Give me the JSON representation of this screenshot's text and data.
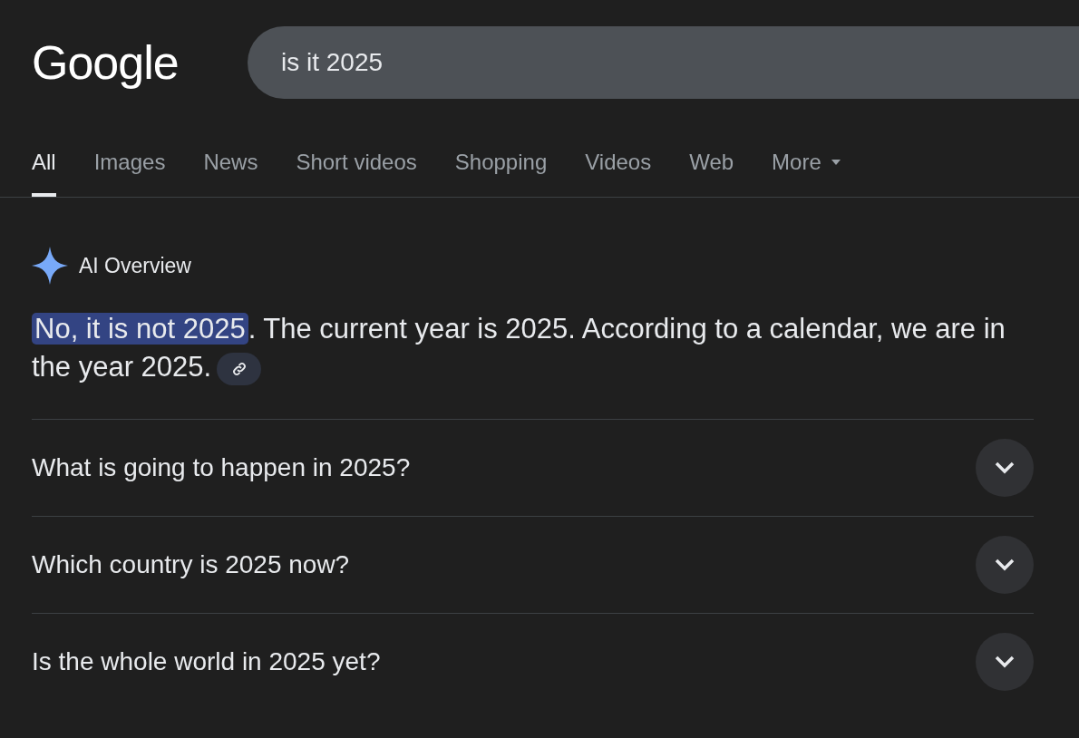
{
  "logo": "Google",
  "search": {
    "value": "is it 2025"
  },
  "tabs": [
    {
      "label": "All",
      "selected": true
    },
    {
      "label": "Images",
      "selected": false
    },
    {
      "label": "News",
      "selected": false
    },
    {
      "label": "Short videos",
      "selected": false
    },
    {
      "label": "Shopping",
      "selected": false
    },
    {
      "label": "Videos",
      "selected": false
    },
    {
      "label": "Web",
      "selected": false
    },
    {
      "label": "More",
      "selected": false,
      "kind": "menu"
    }
  ],
  "overview": {
    "title": "AI Overview",
    "highlight": "No, it is not 2025",
    "text": ". The current year is 2025. According to a calendar, we are in the year 2025."
  },
  "questions": [
    {
      "text": "What is going to happen in 2025?",
      "expanded": false
    },
    {
      "text": "Which country is 2025 now?",
      "expanded": false
    },
    {
      "text": "Is the whole world in 2025 yet?",
      "expanded": false
    }
  ]
}
